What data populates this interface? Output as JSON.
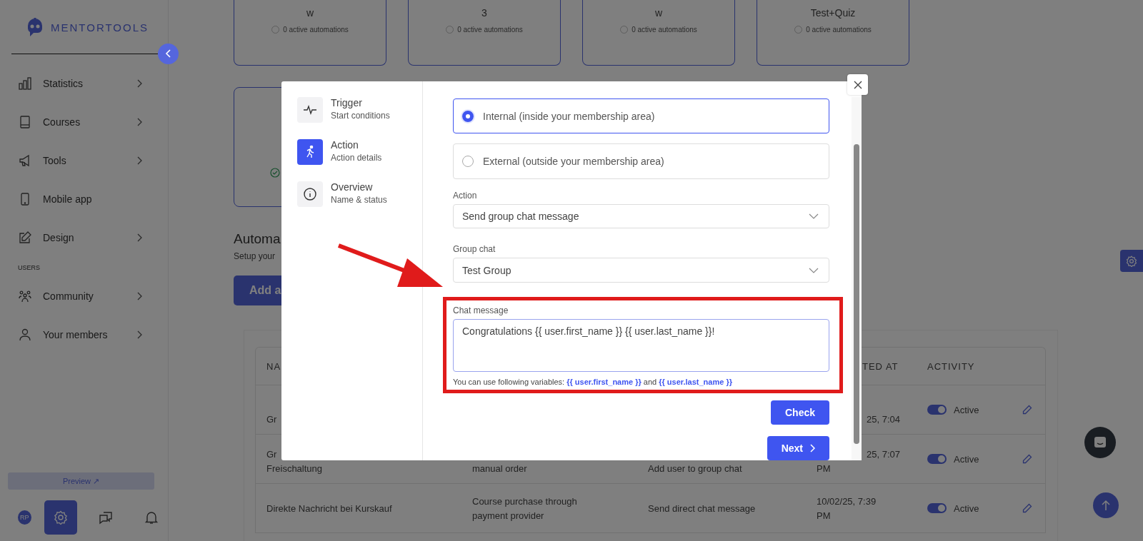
{
  "sidebar": {
    "logo": "MENTORTOOLS",
    "items": [
      {
        "label": "Statistics",
        "has_submenu": true
      },
      {
        "label": "Courses",
        "has_submenu": true
      },
      {
        "label": "Tools",
        "has_submenu": true
      },
      {
        "label": "Mobile app",
        "has_submenu": false
      },
      {
        "label": "Design",
        "has_submenu": true
      }
    ],
    "section_label": "USERS",
    "user_items": [
      {
        "label": "Community",
        "has_submenu": true
      },
      {
        "label": "Your members",
        "has_submenu": true
      }
    ],
    "preview_button": "Preview ↗",
    "avatar": "RP",
    "bottom_tabs": [
      {
        "selected": true
      },
      {
        "selected": false
      },
      {
        "selected": false
      }
    ]
  },
  "cards": [
    {
      "title": "w",
      "status": "0 active automations"
    },
    {
      "title": "3",
      "status": "0 active automations"
    },
    {
      "title": "w",
      "status": "0 active automations"
    },
    {
      "title": "Test+Quiz",
      "status": "0 active automations"
    }
  ],
  "heading": "Automa",
  "subheading": "Setup your",
  "add_button": "Add a",
  "table": {
    "columns": [
      "NA",
      "",
      "",
      "TED AT",
      "ACTIVITY"
    ],
    "rows": [
      {
        "kind": "partial",
        "name": [
          "Gr"
        ],
        "trigger": [],
        "action": [],
        "created": [
          "25, 7:04"
        ],
        "active": true,
        "status": "Active"
      },
      {
        "kind": "partial",
        "name": [
          "Gr",
          "Freischaltung"
        ],
        "trigger": [
          "manual order"
        ],
        "action": [
          "Add user to group chat"
        ],
        "created": [
          "25, 7:07",
          "PM"
        ],
        "active": true,
        "status": "Active"
      },
      {
        "kind": "full",
        "name": [
          "Direkte Nachricht bei Kurskauf"
        ],
        "trigger": [
          "Course purchase through",
          "payment provider"
        ],
        "action": [
          "Send direct chat message"
        ],
        "created": [
          "10/02/25, 7:39",
          "PM"
        ],
        "active": true,
        "status": "Active"
      }
    ]
  },
  "modal": {
    "steps": [
      {
        "title": "Trigger",
        "subtitle": "Start conditions",
        "selected": false
      },
      {
        "title": "Action",
        "subtitle": "Action details",
        "selected": true
      },
      {
        "title": "Overview",
        "subtitle": "Name & status",
        "selected": false
      }
    ],
    "options": [
      {
        "label": "Internal (inside your membership area)",
        "selected": true
      },
      {
        "label": "External (outside your membership area)",
        "selected": false
      }
    ],
    "action_label": "Action",
    "action_value": "Send group chat message",
    "group_label": "Group chat",
    "group_value": "Test Group",
    "message_label": "Chat message",
    "message_value": "Congratulations {{ user.first_name }} {{ user.last_name }}!",
    "hint": "You can use following variables: **{{ user.first_name }}** and **{{ user.last_name }}**",
    "check_button": "Check",
    "next_button": "Next"
  }
}
